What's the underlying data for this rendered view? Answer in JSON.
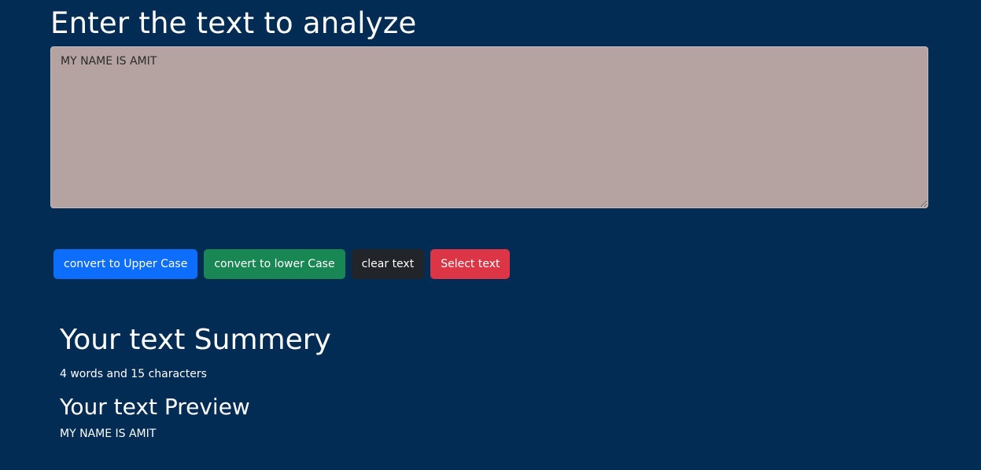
{
  "form": {
    "title": "Enter the text to analyze",
    "textarea_value": "MY NAME IS AMIT"
  },
  "buttons": {
    "upper": "convert to Upper Case",
    "lower": "convert to lower Case",
    "clear": "clear text",
    "select": "Select text"
  },
  "summary": {
    "heading": "Your text Summery",
    "stats": "4 words and 15 characters"
  },
  "preview": {
    "heading": "Your text Preview",
    "text": "MY NAME IS AMIT"
  },
  "colors": {
    "background": "#022c54",
    "textarea_bg": "#b5a3a2",
    "primary": "#0d6efd",
    "success": "#198754",
    "dark": "#212529",
    "danger": "#dc3545"
  }
}
